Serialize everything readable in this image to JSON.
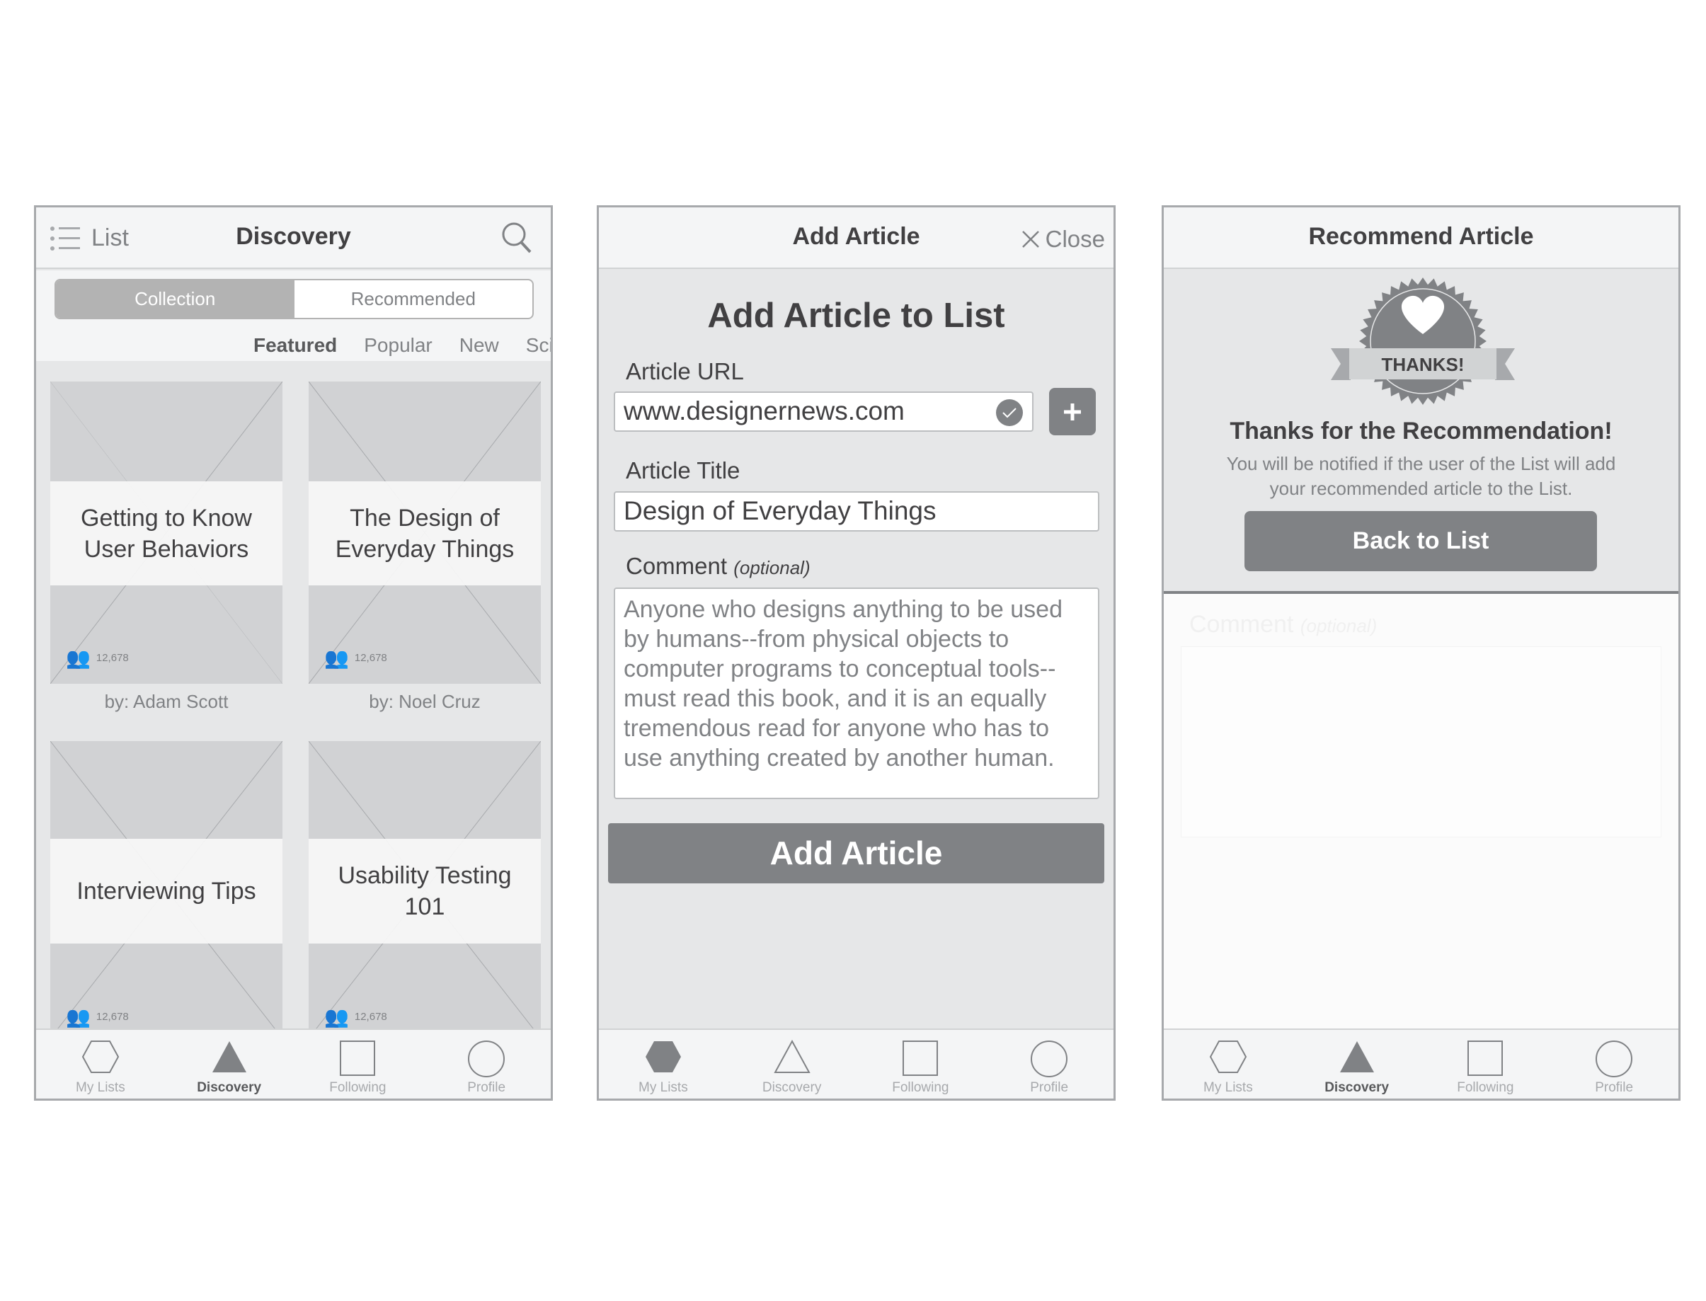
{
  "discovery": {
    "menu_label": "List",
    "title": "Discovery",
    "segments": [
      "Collection",
      "Recommended"
    ],
    "filters": [
      "Featured",
      "Popular",
      "New",
      "Sci"
    ],
    "cards": [
      {
        "title": "Getting to Know User Behaviors",
        "count": "12,678",
        "author": "by: Adam Scott"
      },
      {
        "title": "The Design of Everyday Things",
        "count": "12,678",
        "author": "by: Noel Cruz"
      },
      {
        "title": "Interviewing Tips",
        "count": "12,678"
      },
      {
        "title": "Usability Testing 101",
        "count": "12,678"
      }
    ],
    "active_tab": "Discovery"
  },
  "add_article": {
    "title": "Add Article",
    "close_label": "Close",
    "heading": "Add Article to List",
    "url_label": "Article URL",
    "url_value": "www.designernews.com",
    "title_label": "Article Title",
    "title_value": "Design of Everyday Things",
    "comment_label": "Comment",
    "comment_optional": "(optional)",
    "comment_value": "Anyone who designs anything to be used by humans--from physical objects to computer programs to conceptual tools--must read this book, and it is an equally tremendous read for anyone who has to use anything created by another human.",
    "submit_label": "Add Article",
    "active_tab": "My Lists"
  },
  "recommend": {
    "title": "Recommend Article",
    "badge_text": "THANKS!",
    "heading": "Thanks for the Recommendation!",
    "body": "You will be notified if the user of the List will add your recommended article to the List.",
    "button_label": "Back to List",
    "ghost_label": "Comment",
    "ghost_optional": "(optional)",
    "active_tab": "Discovery"
  },
  "tabs": [
    "My Lists",
    "Discovery",
    "Following",
    "Profile"
  ],
  "colors": {
    "dark_gray": "#808285",
    "text": "#414042",
    "light_bg": "#e6e7e8",
    "header_bg": "#f4f5f6",
    "placeholder": "#d1d2d4"
  }
}
